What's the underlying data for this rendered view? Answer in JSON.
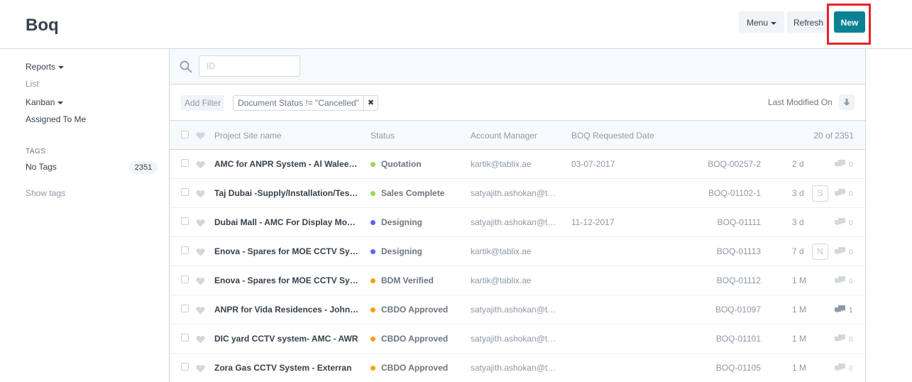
{
  "header": {
    "title": "Boq",
    "menu_label": "Menu",
    "refresh_label": "Refresh",
    "new_label": "New"
  },
  "sidebar": {
    "reports": "Reports",
    "list": "List",
    "kanban": "Kanban",
    "assigned_to_me": "Assigned To Me",
    "tags_heading": "TAGS",
    "no_tags": "No Tags",
    "no_tags_count": "2351",
    "show_tags": "Show tags"
  },
  "search": {
    "placeholder": "ID"
  },
  "filters": {
    "add_filter": "Add Filter",
    "active_filter": "Document Status != \"Cancelled\"",
    "sort_label": "Last Modified On"
  },
  "list": {
    "columns": {
      "project": "Project Site name",
      "status": "Status",
      "manager": "Account Manager",
      "date": "BOQ Requested Date",
      "count": "20 of 2351"
    },
    "rows": [
      {
        "name": "AMC for ANPR System - Al Waleed Holding",
        "status": "Quotation",
        "status_color": "#98d85b",
        "manager": "kartik@tablix.ae",
        "date": "03-07-2017",
        "id": "BOQ-00257-2",
        "modified": "2 d",
        "assigned": "",
        "comments": "0"
      },
      {
        "name": "Taj Dubai -Supply/Installation/Testing",
        "status": "Sales Complete",
        "status_color": "#98d85b",
        "manager": "satyajith.ashokan@tablix.ae",
        "date": "",
        "id": "BOQ-01102-1",
        "modified": "3 d",
        "assigned": "S",
        "comments": "0"
      },
      {
        "name": "Dubai Mall - AMC For Display Monitors",
        "status": "Designing",
        "status_color": "#5e64ff",
        "manager": "satyajith.ashokan@tablix.ae",
        "date": "11-12-2017",
        "id": "BOQ-01111",
        "modified": "3 d",
        "assigned": "",
        "comments": "0"
      },
      {
        "name": "Enova - Spares for MOE CCTV System",
        "status": "Designing",
        "status_color": "#5e64ff",
        "manager": "kartik@tablix.ae",
        "date": "",
        "id": "BOQ-01113",
        "modified": "7 d",
        "assigned": "N",
        "comments": "0"
      },
      {
        "name": "Enova - Spares for MOE CCTV System",
        "status": "BDM Verified",
        "status_color": "#ffa00a",
        "manager": "kartik@tablix.ae",
        "date": "",
        "id": "BOQ-01112",
        "modified": "1 M",
        "assigned": "",
        "comments": "0"
      },
      {
        "name": "ANPR for Vida Residences - Johnson Controls",
        "status": "CBDO Approved",
        "status_color": "#ffa00a",
        "manager": "satyajith.ashokan@tablix.ae",
        "date": "",
        "id": "BOQ-01097",
        "modified": "1 M",
        "assigned": "",
        "comments": "1"
      },
      {
        "name": "DIC yard CCTV system- AMC - AWR",
        "status": "CBDO Approved",
        "status_color": "#ffa00a",
        "manager": "satyajith.ashokan@tablix.ae",
        "date": "",
        "id": "BOQ-01101",
        "modified": "1 M",
        "assigned": "",
        "comments": "0"
      },
      {
        "name": "Zora Gas CCTV System - Exterran",
        "status": "CBDO Approved",
        "status_color": "#ffa00a",
        "manager": "satyajith.ashokan@tablix.ae",
        "date": "",
        "id": "BOQ-01105",
        "modified": "1 M",
        "assigned": "",
        "comments": "0"
      }
    ]
  },
  "colors": {
    "primary": "#0b8195",
    "highlight": "#e8222b"
  }
}
